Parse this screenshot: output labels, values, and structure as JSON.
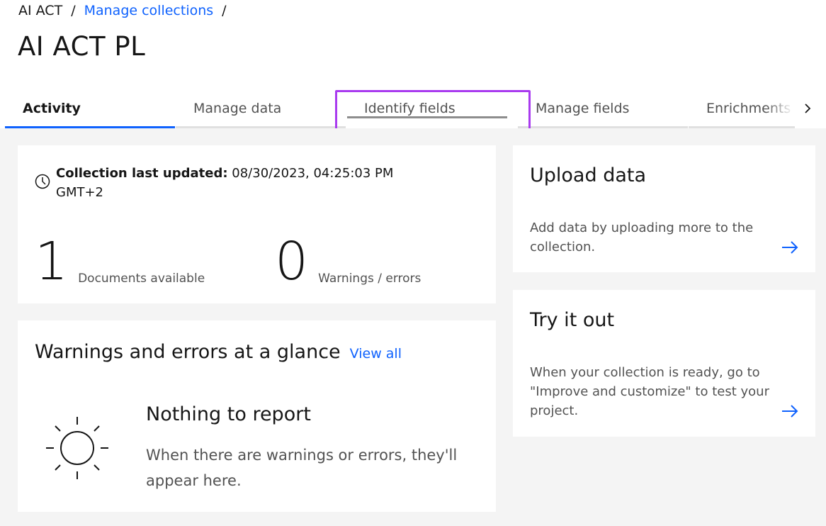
{
  "breadcrumb": {
    "root": "AI ACT",
    "manage": "Manage collections",
    "sep": "/"
  },
  "page_title": "AI ACT PL",
  "tabs": [
    {
      "label": "Activity",
      "state": "active"
    },
    {
      "label": "Manage data",
      "state": "default"
    },
    {
      "label": "Identify fields",
      "state": "hover"
    },
    {
      "label": "Manage fields",
      "state": "default"
    },
    {
      "label": "Enrichments",
      "state": "default"
    }
  ],
  "tab_scroll_icon": "chevron-right-icon",
  "highlight_color": "#a93bef",
  "stats": {
    "updated_label": "Collection last updated:",
    "updated_value": "08/30/2023, 04:25:03 PM GMT+2",
    "documents_count": "1",
    "documents_label": "Documents available",
    "warnings_count": "0",
    "warnings_label": "Warnings / errors"
  },
  "glance": {
    "title": "Warnings and errors at a glance",
    "view_all": "View all",
    "empty_title": "Nothing to report",
    "empty_desc": "When there are warnings or errors, they'll appear here."
  },
  "upload_tile": {
    "title": "Upload data",
    "desc": "Add data by uploading more to the collection."
  },
  "try_tile": {
    "title": "Try it out",
    "desc": "When your collection is ready, go to \"Improve and customize\" to test your project."
  },
  "colors": {
    "link": "#0f62fe",
    "active_tab": "#0f62fe",
    "background": "#f4f4f4"
  }
}
